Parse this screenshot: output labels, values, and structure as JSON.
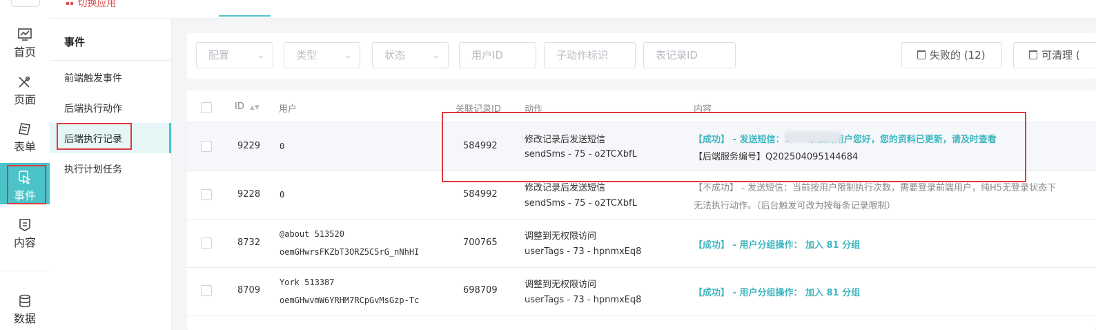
{
  "topbar": {
    "switch_app_label": "切换应用"
  },
  "nav": {
    "items": [
      {
        "label": "首页",
        "icon": "chart-monitor-icon"
      },
      {
        "label": "页面",
        "icon": "design-tools-icon"
      },
      {
        "label": "表单",
        "icon": "form-edit-icon"
      },
      {
        "label": "事件",
        "icon": "event-click-icon",
        "active": true
      },
      {
        "label": "内容",
        "icon": "content-doc-icon"
      },
      {
        "label": "数据",
        "icon": "database-icon"
      }
    ]
  },
  "subnav": {
    "title": "事件",
    "items": [
      "前端触发事件",
      "后端执行动作",
      "后端执行记录",
      "执行计划任务"
    ]
  },
  "filters": {
    "config": "配置",
    "type": "类型",
    "status": "状态",
    "user_id": "用户ID",
    "sub_action": "子动作标识",
    "record_id": "表记录ID",
    "failed_btn": "失败的 (12)",
    "clearable_btn": "可清理 ("
  },
  "table": {
    "headers": {
      "id": "ID",
      "user": "用户",
      "rel_id": "关联记录ID",
      "action": "动作",
      "content": "内容"
    },
    "rows": [
      {
        "id": "9229",
        "user1": "0",
        "user2": "",
        "rel": "584992",
        "action1": "修改记录后发送短信",
        "action2": "sendSms - 75 - o2TCXbfL",
        "content1": "【成功】 - 发送短信：1          -> 亲爱的用户您好，您的资料已更新，请及时查看",
        "content2": "【后端服务编号】Q202504095144684"
      },
      {
        "id": "9228",
        "user1": "0",
        "user2": "",
        "rel": "584992",
        "action1": "修改记录后发送短信",
        "action2": "sendSms - 75 - o2TCXbfL",
        "content1": "【不成功】 - 发送短信：当前按用户限制执行次数，需要登录前端用户，纯H5无登录状态下",
        "content2": "无法执行动作。（后台触发可改为按每条记录限制）"
      },
      {
        "id": "8732",
        "user1": "@about 513520",
        "user2": "oemGHwrsFKZbT3ORZ5C5rG_nNhHI",
        "rel": "700765",
        "action1": "调整到无权限访问",
        "action2": "userTags - 73 - hpnmxEq8",
        "content1": "【成功】 - 用户分组操作： 加入 81 分组",
        "content2": ""
      },
      {
        "id": "8709",
        "user1": "York 513387",
        "user2": "oemGHwvmW6YRHM7RCpGvMsGzp-Tc",
        "rel": "698709",
        "action1": "调整到无权限访问",
        "action2": "userTags - 73 - hpnmxEq8",
        "content1": "【成功】 - 用户分组操作： 加入 81 分组",
        "content2": ""
      }
    ]
  },
  "colors": {
    "accent": "#4cc3c9",
    "highlight_red": "#e0393e",
    "success_text": "#3fb7c1"
  }
}
